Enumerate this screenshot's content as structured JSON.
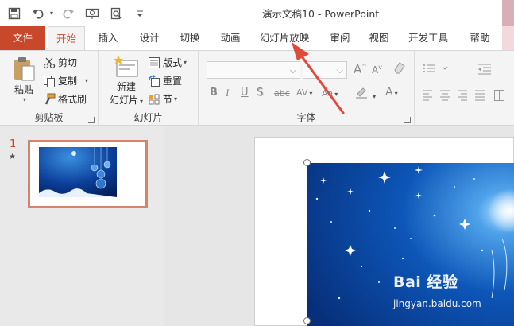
{
  "titlebar": {
    "title": "演示文稿10  -  PowerPoint",
    "qat": [
      "save-icon",
      "undo-icon",
      "redo-icon",
      "present-from-start-icon",
      "print-preview-icon",
      "customize-qat-icon"
    ]
  },
  "tabs": [
    "文件",
    "开始",
    "插入",
    "设计",
    "切换",
    "动画",
    "幻灯片放映",
    "审阅",
    "视图",
    "开发工具",
    "帮助"
  ],
  "active_tab": "开始",
  "ribbon": {
    "clipboard": {
      "label": "剪贴板",
      "paste": "粘贴",
      "cut": "剪切",
      "copy": "复制",
      "format_painter": "格式刷"
    },
    "slides": {
      "label": "幻灯片",
      "new_slide_line1": "新建",
      "new_slide_line2": "幻灯片",
      "layout": "版式",
      "reset": "重置",
      "section": "节"
    },
    "font": {
      "label": "字体",
      "bold": "B",
      "italic": "I",
      "underline": "U",
      "shadow": "S",
      "strikethrough": "abc",
      "spacing": "AV",
      "case": "Aa",
      "grow": "A",
      "shrink": "A",
      "font_color": "A"
    }
  },
  "slides_panel": {
    "number": "1",
    "star": "★"
  },
  "watermark": {
    "brand": "Bai 经验",
    "url": "jingyan.baidu.com"
  },
  "colors": {
    "accent": "#c7482a",
    "thumb_border": "#d6836c",
    "slide_blue": "#0a4aa8",
    "arrow": "#e04a3a"
  }
}
